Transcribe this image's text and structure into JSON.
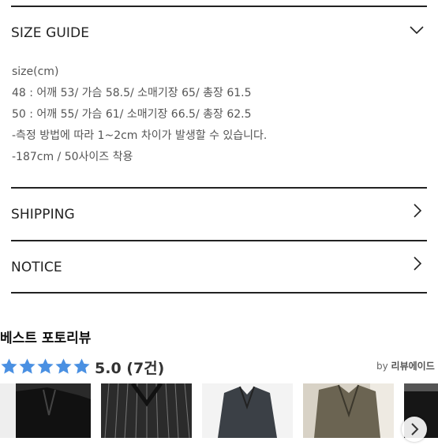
{
  "sections": {
    "size_guide": {
      "title": "SIZE GUIDE",
      "expanded": true
    },
    "shipping": {
      "title": "SHIPPING",
      "expanded": false
    },
    "notice": {
      "title": "NOTICE",
      "expanded": false
    }
  },
  "size_guide_body": [
    "size(cm)",
    "48 : 어깨 53/ 가슴 58.5/ 소매기장 65/ 총장 61.5",
    "50 : 어깨 55/ 가슴 61/ 소매기장 66.5/ 총장 62.5",
    "-측정 방법에 따라 1~2cm 차이가 발생할 수 있습니다.",
    "-187cm / 50사이즈 착용"
  ],
  "reviews": {
    "heading": "베스트 포토리뷰",
    "rating": 5.0,
    "score_text": "5.0 (7건)",
    "by_prefix": "by",
    "by_brand": "리뷰에이드",
    "star_color": "#4a90e2"
  },
  "icons": {
    "expanded": "chevron-down-icon",
    "collapsed": "chevron-right-icon",
    "next": "arrow-right-icon"
  }
}
